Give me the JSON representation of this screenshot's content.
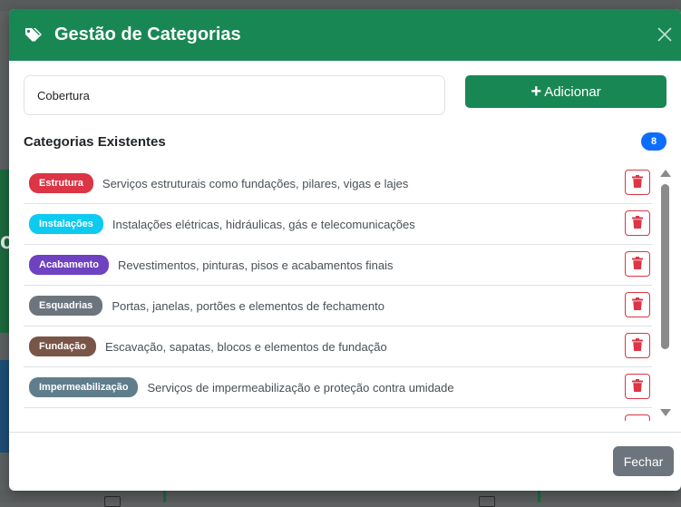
{
  "modal": {
    "title": "Gestão de Categorias",
    "title_icon": "tags-icon",
    "close_icon": "close-icon"
  },
  "form": {
    "input_value": "Cobertura",
    "add_label": "Adicionar",
    "add_icon": "plus-icon"
  },
  "list": {
    "title": "Categorias Existentes",
    "count": "8",
    "items": [
      {
        "label": "Estrutura",
        "description": "Serviços estruturais como fundações, pilares, vigas e lajes",
        "color": "#dc3545"
      },
      {
        "label": "Instalações",
        "description": "Instalações elétricas, hidráulicas, gás e telecomunicações",
        "color": "#0dcaf0"
      },
      {
        "label": "Acabamento",
        "description": "Revestimentos, pinturas, pisos e acabamentos finais",
        "color": "#6f42c1"
      },
      {
        "label": "Esquadrias",
        "description": "Portas, janelas, portões e elementos de fechamento",
        "color": "#6c757d"
      },
      {
        "label": "Fundação",
        "description": "Escavação, sapatas, blocos e elementos de fundação",
        "color": "#795548"
      },
      {
        "label": "Impermeabilização",
        "description": "Serviços de impermeabilização e proteção contra umidade",
        "color": "#607d8b"
      }
    ]
  },
  "footer": {
    "close_label": "Fechar"
  },
  "colors": {
    "header": "#198754",
    "danger": "#dc3545",
    "badge_count": "#0d6efd"
  }
}
